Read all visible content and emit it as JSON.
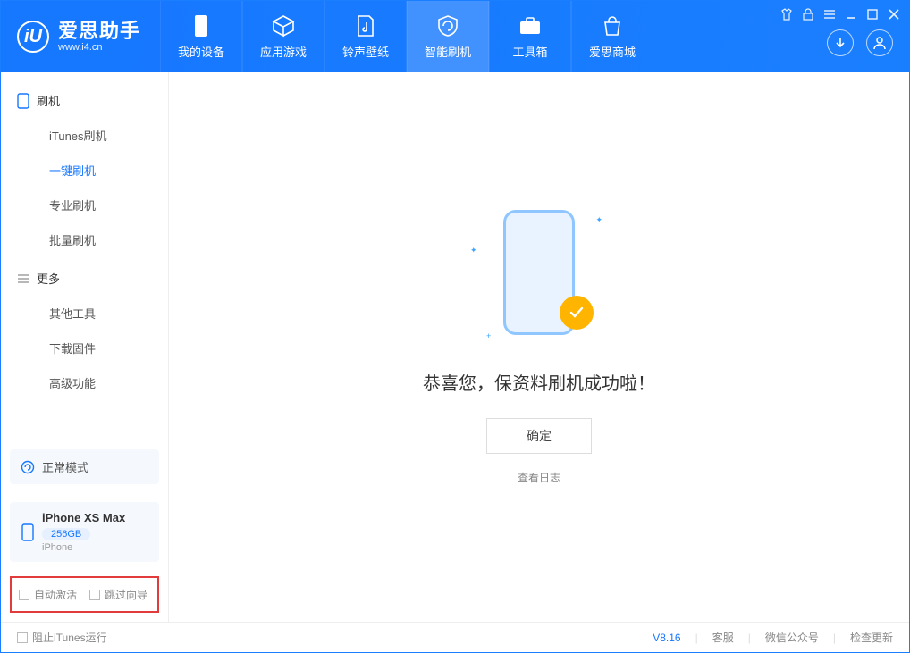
{
  "app": {
    "logo_char": "iU",
    "title": "爱思助手",
    "subtitle": "www.i4.cn"
  },
  "nav": {
    "my_device": "我的设备",
    "apps_games": "应用游戏",
    "ring_wall": "铃声壁纸",
    "smart_flash": "智能刷机",
    "toolbox": "工具箱",
    "store": "爱思商城"
  },
  "sidebar": {
    "section_flash": "刷机",
    "items": {
      "itunes": "iTunes刷机",
      "onekey": "一键刷机",
      "pro": "专业刷机",
      "batch": "批量刷机"
    },
    "section_more": "更多",
    "more": {
      "other_tools": "其他工具",
      "download_fw": "下载固件",
      "advanced": "高级功能"
    }
  },
  "device": {
    "mode_label": "正常模式",
    "name": "iPhone XS Max",
    "capacity": "256GB",
    "type": "iPhone"
  },
  "options": {
    "auto_activate": "自动激活",
    "skip_guide": "跳过向导"
  },
  "main": {
    "success": "恭喜您，保资料刷机成功啦！",
    "ok": "确定",
    "view_log": "查看日志"
  },
  "footer": {
    "block_itunes": "阻止iTunes运行",
    "version": "V8.16",
    "support": "客服",
    "wechat": "微信公众号",
    "check_update": "检查更新"
  }
}
